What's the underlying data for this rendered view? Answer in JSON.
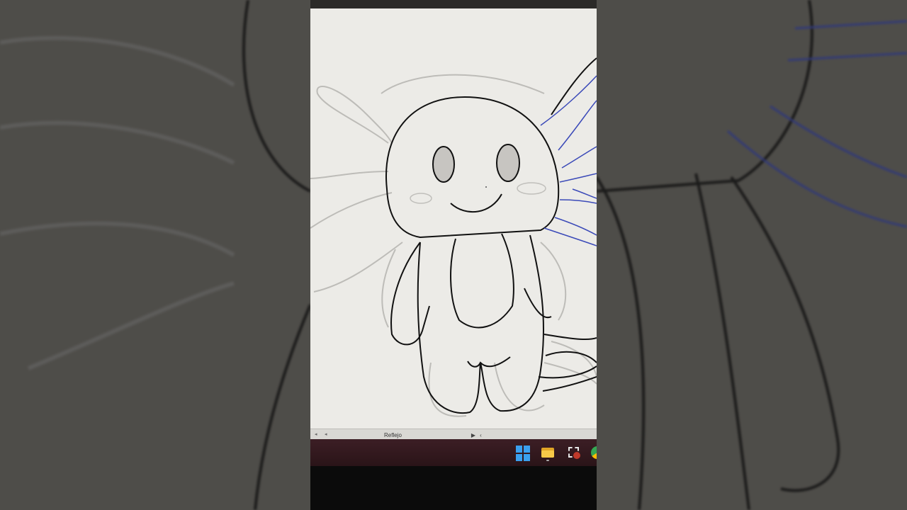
{
  "status_bar": {
    "tool_label": "Reflejo"
  },
  "taskbar": {
    "icons": [
      "windows-start-icon",
      "file-explorer-icon",
      "snipping-tool-icon",
      "chrome-icon"
    ]
  },
  "colors": {
    "canvas": "#ecebe7",
    "sketch_line": "#111111",
    "guide_line": "#b8b7b3",
    "gill_line": "#3a49b8",
    "taskbar": "#3c1e25"
  }
}
